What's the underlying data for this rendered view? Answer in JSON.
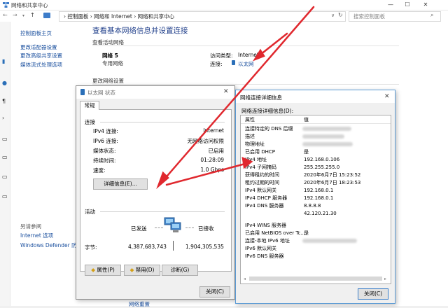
{
  "window": {
    "title": "网络和共享中心",
    "minimize": "—",
    "maximize": "☐",
    "close": "✕"
  },
  "address": {
    "path": [
      "控制面板",
      "网络和 Internet",
      "网络和共享中心"
    ],
    "search_placeholder": "搜索控制面板"
  },
  "sidebar": {
    "items": [
      "控制面板主页",
      "更改适配器设置",
      "更改高级共享设置",
      "媒体流式处理选项"
    ],
    "see_also_header": "另请参阅",
    "see_also": [
      "Internet 选项",
      "Windows Defender 防火墙"
    ]
  },
  "main": {
    "heading": "查看基本网络信息并设置连接",
    "active_section": "查看活动网络",
    "network_name": "网络 5",
    "network_type": "专用网络",
    "access_type_label": "访问类型:",
    "access_type_value": "Internet",
    "connection_label": "连接:",
    "connection_value": "以太网",
    "change_section": "更改网络设置",
    "bottom_partial": "网络重置"
  },
  "status_dialog": {
    "title": "以太网 状态",
    "tab": "常规",
    "connection_group": "连接",
    "rows": [
      {
        "label": "IPv4 连接:",
        "value": "Internet"
      },
      {
        "label": "IPv6 连接:",
        "value": "无网络访问权限"
      },
      {
        "label": "媒体状态:",
        "value": "已启用"
      },
      {
        "label": "持续时间:",
        "value": "01:28:09"
      },
      {
        "label": "速度:",
        "value": "1.0 Gbps"
      }
    ],
    "details_button": "详细信息(E)...",
    "activity_group": "活动",
    "sent_label": "已发送",
    "received_label": "已接收",
    "bytes_label": "字节:",
    "bytes_sent": "4,387,683,743",
    "bytes_received": "1,904,305,535",
    "properties_button": "属性(P)",
    "disable_button": "禁用(D)",
    "diagnose_button": "诊断(G)",
    "close_button": "关闭(C)"
  },
  "details_dialog": {
    "title": "网络连接详细信息",
    "group_label": "网络连接详细信息(D):",
    "col_property": "属性",
    "col_value": "值",
    "rows": [
      {
        "p": "连接特定的 DNS 后缀",
        "v": ""
      },
      {
        "p": "描述",
        "v": ""
      },
      {
        "p": "物理地址",
        "v": ""
      },
      {
        "p": "已启用 DHCP",
        "v": "是"
      },
      {
        "p": "IPv4 地址",
        "v": "192.168.0.106"
      },
      {
        "p": "IPv4 子网掩码",
        "v": "255.255.255.0"
      },
      {
        "p": "获得租约的时间",
        "v": "2020年6月7日 15:23:52"
      },
      {
        "p": "租约过期的时间",
        "v": "2020年6月7日 18:23:53"
      },
      {
        "p": "IPv4 默认网关",
        "v": "192.168.0.1"
      },
      {
        "p": "IPv4 DHCP 服务器",
        "v": "192.168.0.1"
      },
      {
        "p": "IPv4 DNS 服务器",
        "v": "8.8.8.8"
      },
      {
        "p": "",
        "v": "42.120.21.30"
      },
      {
        "p": "IPv4 WINS 服务器",
        "v": ""
      },
      {
        "p": "已启用 NetBIOS over Tc...",
        "v": "是"
      },
      {
        "p": "连接-本地 IPv6 地址",
        "v": ""
      },
      {
        "p": "IPv6 默认网关",
        "v": ""
      },
      {
        "p": "IPv6 DNS 服务器",
        "v": ""
      }
    ],
    "close_button": "关闭(C)"
  },
  "colors": {
    "link": "#1a4f9e",
    "heading": "#1f3e8a",
    "annotation_arrow": "#e0282e",
    "accent": "#3c7fc9"
  }
}
